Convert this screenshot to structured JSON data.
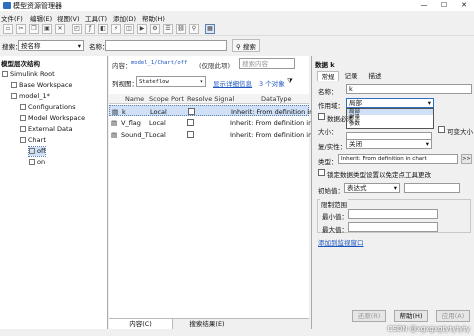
{
  "window": {
    "title": "模型资源管理器",
    "minimize": "—",
    "maximize": "☐",
    "close": "✕"
  },
  "menu": [
    "文件(F)",
    "编辑(E)",
    "视图(V)",
    "工具(T)",
    "添加(D)",
    "帮助(H)"
  ],
  "search_row": {
    "search_label": "搜索：",
    "search_by": "按名称",
    "name_label": "名称：",
    "search_button": "搜索"
  },
  "left_panel": {
    "header": "模型层次结构",
    "tree": [
      {
        "label": "Simulink Root",
        "depth": 0,
        "icon": "root-icon"
      },
      {
        "label": "Base Workspace",
        "depth": 1,
        "icon": "workspace-icon"
      },
      {
        "label": "model_1*",
        "depth": 1,
        "icon": "model-icon"
      },
      {
        "label": "Configurations",
        "depth": 2,
        "icon": "config-icon"
      },
      {
        "label": "Model Workspace",
        "depth": 2,
        "icon": "workspace-icon"
      },
      {
        "label": "External Data",
        "depth": 2,
        "icon": "data-icon"
      },
      {
        "label": "Chart",
        "depth": 2,
        "icon": "chart-icon"
      },
      {
        "label": "off",
        "depth": 3,
        "icon": "state-icon",
        "selected": true
      },
      {
        "label": "on",
        "depth": 3,
        "icon": "state-icon"
      }
    ]
  },
  "middle_panel": {
    "content_label": "内容：",
    "content_path": "model_1/Chart/off",
    "content_suffix": "(仅限此项)",
    "search_placeholder": "搜索内容",
    "view_label": "列视图：",
    "view_value": "Stateflow",
    "show_details": "显示详细信息",
    "object_count": "3 个对象",
    "columns": [
      "Name",
      "Scope",
      "Port",
      "Resolve Signal",
      "DataType"
    ],
    "rows": [
      {
        "name": "k",
        "scope": "Local",
        "datatype": "Inherit: From definition in",
        "selected": true
      },
      {
        "name": "V_flag",
        "scope": "Local",
        "datatype": "Inherit: From definition in"
      },
      {
        "name": "Sound_T",
        "scope": "Local",
        "datatype": "Inherit: From definition in"
      }
    ],
    "bottom_tabs": [
      "内容(C)",
      "搜索结果(E)"
    ]
  },
  "right_panel": {
    "title": "数据 k",
    "tabs": [
      "常规",
      "记录",
      "描述"
    ],
    "name_label": "名称：",
    "name_value": "k",
    "scope_label": "作用域：",
    "scope_value": "局部",
    "scope_options": [
      "局部",
      "常量",
      "参数"
    ],
    "must_resolve": "数据必须",
    "variable_size": "可变大小",
    "size_label": "大小：",
    "complexity_label": "复/实性：",
    "complexity_value": "关闭",
    "type_label": "类型：",
    "type_value": "Inherit: From definition in chart",
    "lock_type": "锁定数据类型设置以免定点工具更改",
    "init_label": "初始值：",
    "init_value": "表达式",
    "limit_header": "限制范围",
    "min_label": "最小值：",
    "max_label": "最大值：",
    "add_watch": "添加到监视窗口",
    "buttons": [
      "还原(R)",
      "帮助(H)",
      "应用(A)"
    ]
  },
  "watermark": "CSDN @xgxgxgtytytyty"
}
